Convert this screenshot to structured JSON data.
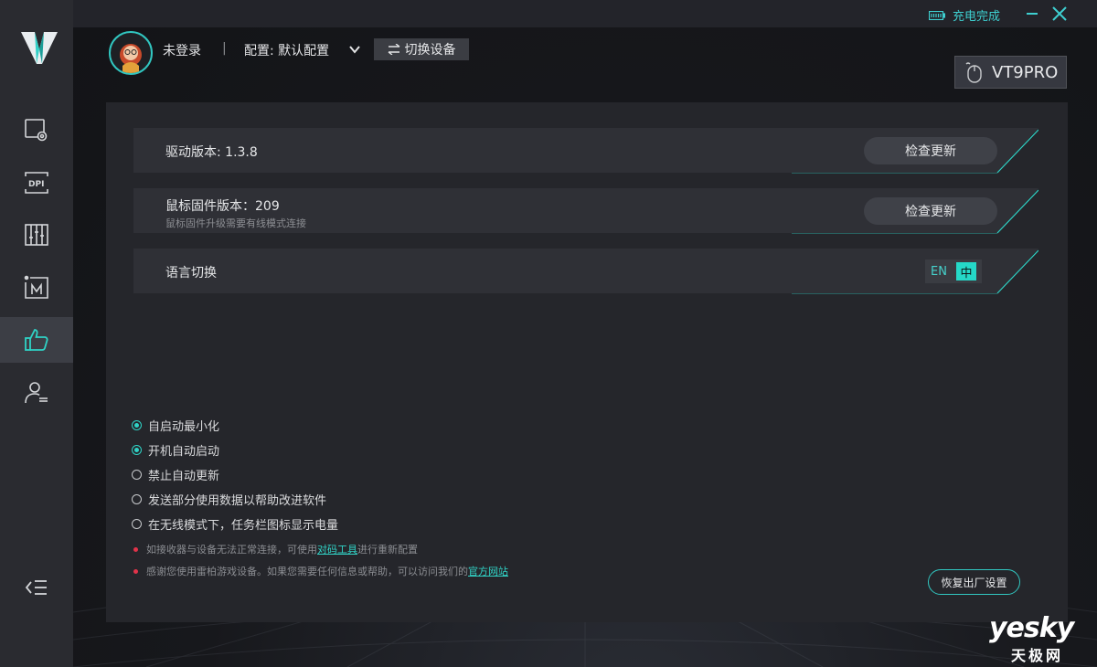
{
  "window": {
    "charge_status": "充电完成",
    "minimize_icon": "minus-icon",
    "close_icon": "x-icon"
  },
  "sidebar": {
    "logo": "V-logo",
    "items": [
      {
        "icon": "screen-settings-icon",
        "active": false
      },
      {
        "icon": "dpi-icon",
        "label": "DPI",
        "active": false
      },
      {
        "icon": "equalizer-sliders-icon",
        "active": false
      },
      {
        "icon": "macro-m-icon",
        "label": "M",
        "active": false
      },
      {
        "icon": "thumbs-up-icon",
        "active": true
      },
      {
        "icon": "user-list-icon",
        "active": false
      }
    ],
    "collapse_icon": "collapse-menu-icon"
  },
  "header": {
    "login_text": "未登录",
    "separator": "|",
    "config_text": "配置: 默认配置",
    "switch_device_label": "切换设备",
    "device_name": "VT9PRO"
  },
  "settings": {
    "driver": {
      "label": "驱动版本: 1.3.8",
      "button": "检查更新"
    },
    "firmware": {
      "label": "鼠标固件版本：209",
      "sublabel": "鼠标固件升级需要有线模式连接",
      "button": "检查更新"
    },
    "language": {
      "label": "语言切换",
      "options": [
        "EN",
        "中"
      ],
      "selected": "中"
    }
  },
  "options": [
    {
      "label": "自启动最小化",
      "checked": true
    },
    {
      "label": "开机自动启动",
      "checked": true
    },
    {
      "label": "禁止自动更新",
      "checked": false
    },
    {
      "label": "发送部分使用数据以帮助改进软件",
      "checked": false
    },
    {
      "label": "在无线模式下，任务栏图标显示电量",
      "checked": false
    }
  ],
  "notes": [
    {
      "before": "如接收器与设备无法正常连接，可使用",
      "link": "对码工具",
      "after": "进行重新配置"
    },
    {
      "before": "感谢您使用雷柏游戏设备。如果您需要任何信息或帮助，可以访问我们的",
      "link": "官方网站",
      "after": ""
    }
  ],
  "reset_button": "恢复出厂设置",
  "watermark": {
    "top": "yesky",
    "bottom": "天极网"
  },
  "colors": {
    "accent": "#2fd3c6",
    "panel": "#25262b",
    "row": "#2f3036",
    "sidebar": "#2a2b30",
    "note_dot": "#e2334a"
  }
}
